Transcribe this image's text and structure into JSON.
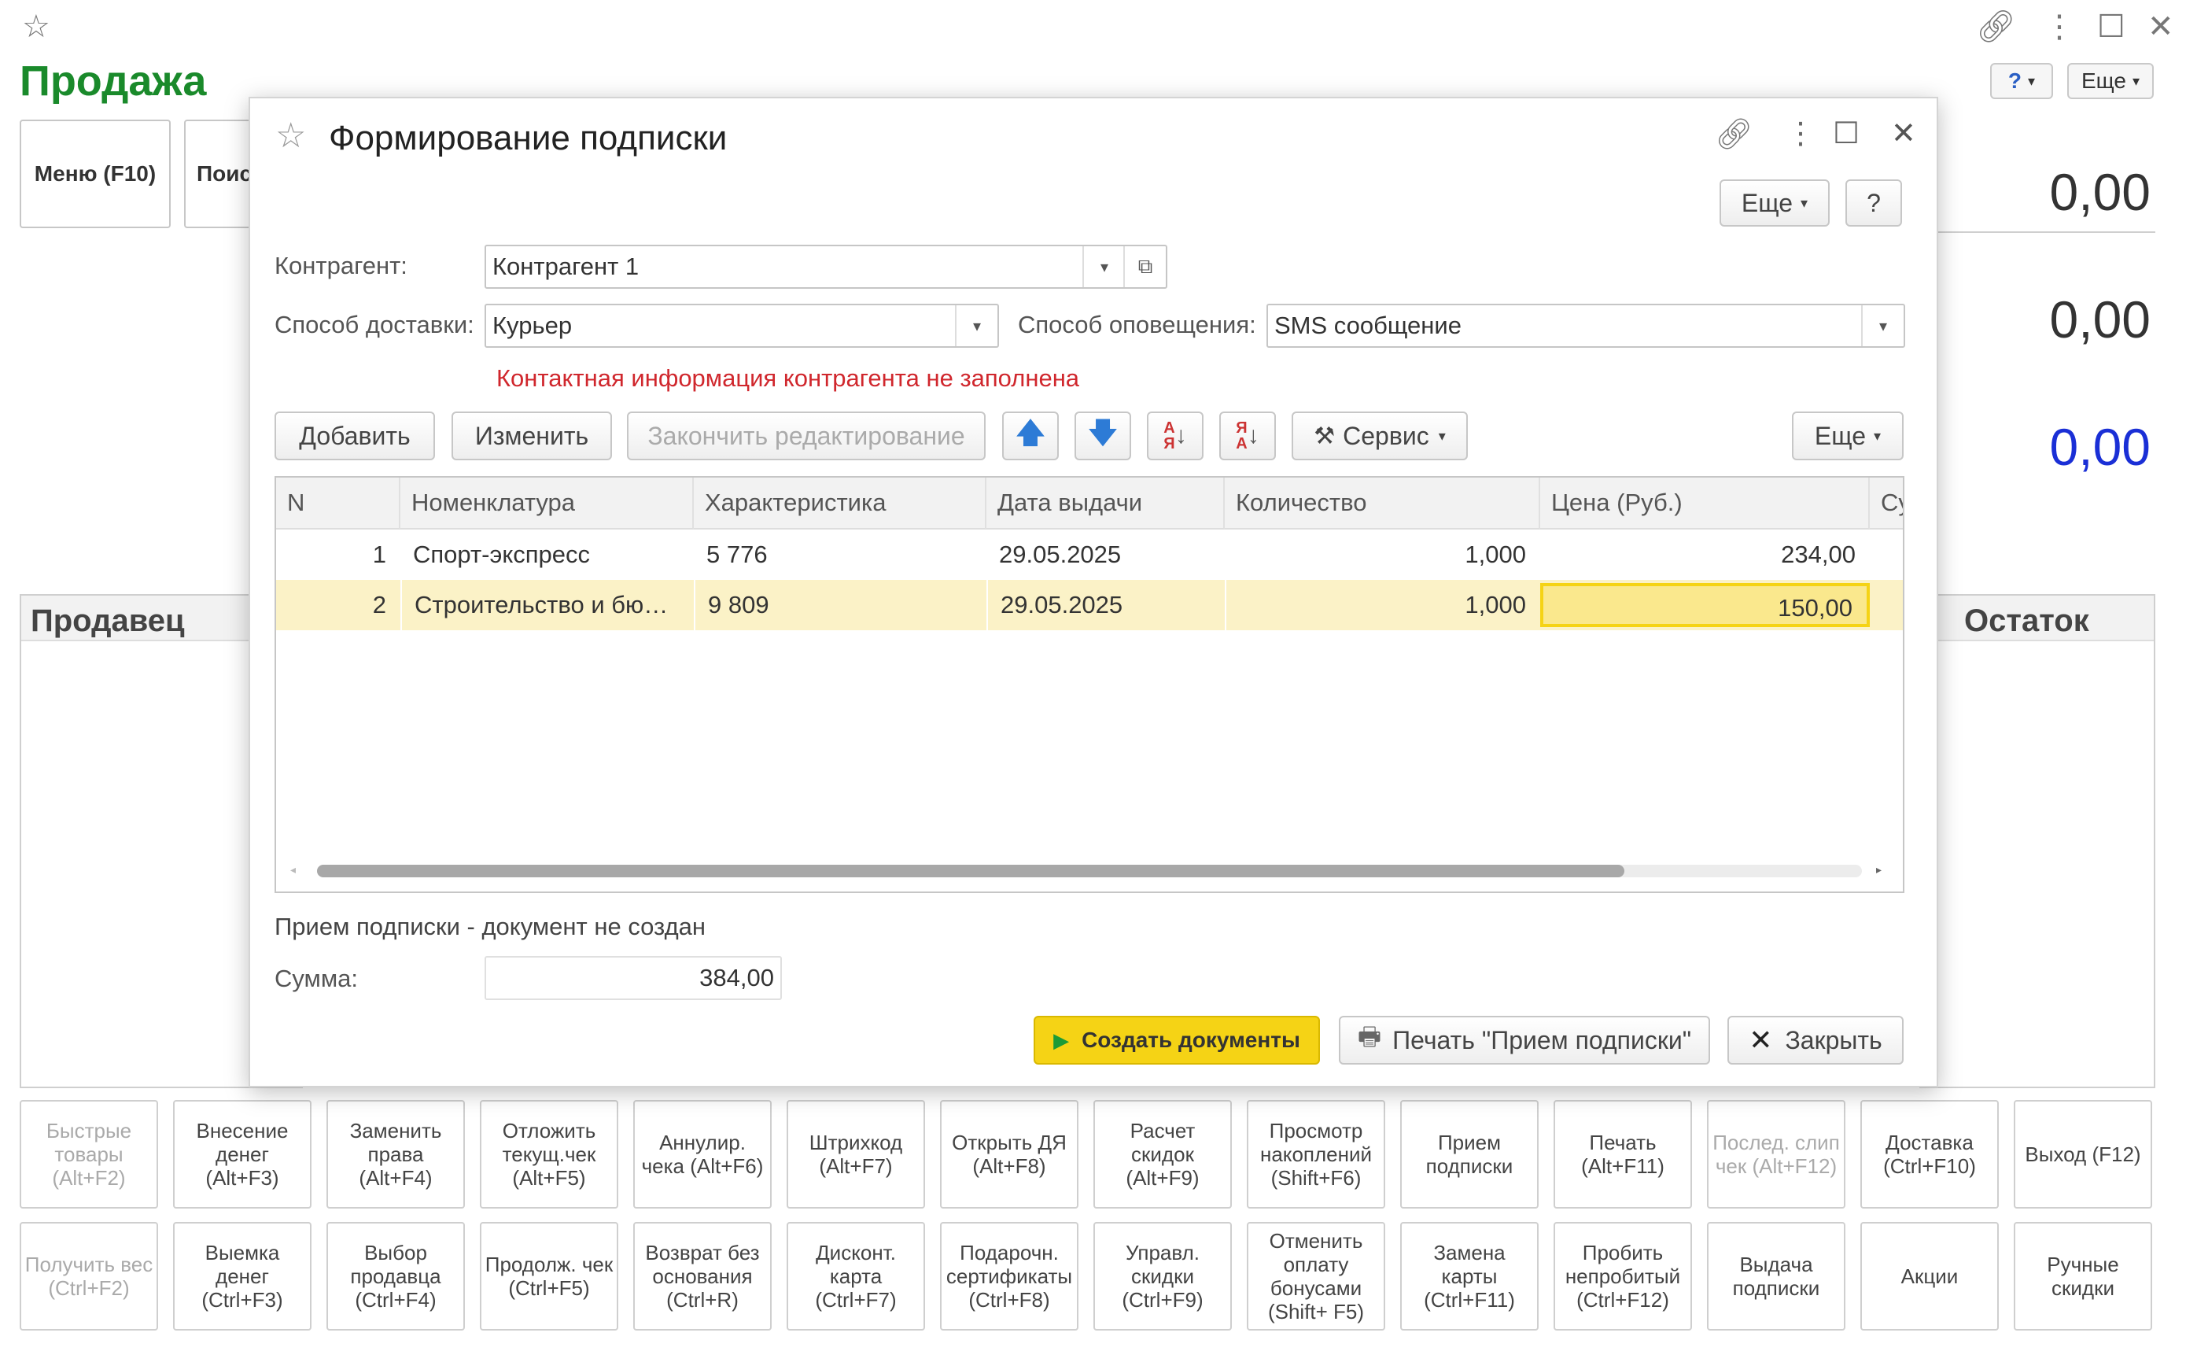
{
  "app": {
    "title": "Продажа",
    "menu_button": "Меню (F10)",
    "search_button": "Поис",
    "more_button": "Еще",
    "help_badge": "?",
    "totals": [
      "0,00",
      "0,00",
      "0,00"
    ],
    "seller_header": "Продавец",
    "remainder_header": "Остаток"
  },
  "function_keys_row1": [
    {
      "label": "Быстрые товары (Alt+F2)",
      "disabled": true
    },
    {
      "label": "Внесение денег (Alt+F3)",
      "disabled": false
    },
    {
      "label": "Заменить права (Alt+F4)",
      "disabled": false
    },
    {
      "label": "Отложить текущ.чек (Alt+F5)",
      "disabled": false
    },
    {
      "label": "Аннулир. чека (Alt+F6)",
      "disabled": false
    },
    {
      "label": "Штрихкод (Alt+F7)",
      "disabled": false
    },
    {
      "label": "Открыть ДЯ (Alt+F8)",
      "disabled": false
    },
    {
      "label": "Расчет скидок (Alt+F9)",
      "disabled": false
    },
    {
      "label": "Просмотр накоплений (Shift+F6)",
      "disabled": false
    },
    {
      "label": "Прием подписки",
      "disabled": false
    },
    {
      "label": "Печать (Alt+F11)",
      "disabled": false
    },
    {
      "label": "Послед. слип чек (Alt+F12)",
      "disabled": true
    },
    {
      "label": "Доставка (Ctrl+F10)",
      "disabled": false
    },
    {
      "label": "Выход (F12)",
      "disabled": false
    }
  ],
  "function_keys_row2": [
    {
      "label": "Получить вес (Ctrl+F2)",
      "disabled": true
    },
    {
      "label": "Выемка денег (Ctrl+F3)",
      "disabled": false
    },
    {
      "label": "Выбор продавца (Ctrl+F4)",
      "disabled": false
    },
    {
      "label": "Продолж. чек (Ctrl+F5)",
      "disabled": false
    },
    {
      "label": "Возврат без основания (Ctrl+R)",
      "disabled": false
    },
    {
      "label": "Дисконт. карта (Ctrl+F7)",
      "disabled": false
    },
    {
      "label": "Подарочн. сертификаты (Ctrl+F8)",
      "disabled": false
    },
    {
      "label": "Управл. скидки (Ctrl+F9)",
      "disabled": false
    },
    {
      "label": "Отменить оплату бонусами (Shift+ F5)",
      "disabled": false
    },
    {
      "label": "Замена карты (Ctrl+F11)",
      "disabled": false
    },
    {
      "label": "Пробить непробитый (Ctrl+F12)",
      "disabled": false
    },
    {
      "label": "Выдача подписки",
      "disabled": false
    },
    {
      "label": "Акции",
      "disabled": false
    },
    {
      "label": "Ручные скидки",
      "disabled": false
    }
  ],
  "dialog": {
    "title": "Формирование подписки",
    "more_button": "Еще",
    "help_button": "?",
    "counterparty_label": "Контрагент:",
    "counterparty_value": "Контрагент 1",
    "delivery_label": "Способ доставки:",
    "delivery_value": "Курьер",
    "notify_label": "Способ оповещения:",
    "notify_value": "SMS сообщение",
    "warning": "Контактная информация контрагента не заполнена",
    "toolbar": {
      "add": "Добавить",
      "edit": "Изменить",
      "finish": "Закончить редактирование",
      "service": "Сервис",
      "more": "Еще"
    },
    "table": {
      "headers": [
        "N",
        "Номенклатура",
        "Характеристика",
        "Дата выдачи",
        "Количество",
        "Цена (Руб.)",
        "Су"
      ],
      "rows": [
        {
          "n": "1",
          "item": "Спорт-экспресс",
          "char": "5 776",
          "date": "29.05.2025",
          "qty": "1,000",
          "price": "234,00"
        },
        {
          "n": "2",
          "item": "Строительство и бю…",
          "char": "9 809",
          "date": "29.05.2025",
          "qty": "1,000",
          "price": "150,00"
        }
      ],
      "selected_row": 2
    },
    "status": "Прием подписки - документ не создан",
    "sum_label": "Сумма:",
    "sum_value": "384,00",
    "create_button": "Создать документы",
    "print_button": "Печать \"Прием подписки\"",
    "close_button": "Закрыть",
    "colors": {
      "accent": "#f5d315",
      "warning": "#d0272d",
      "selected_row": "#fbf2c7"
    }
  }
}
